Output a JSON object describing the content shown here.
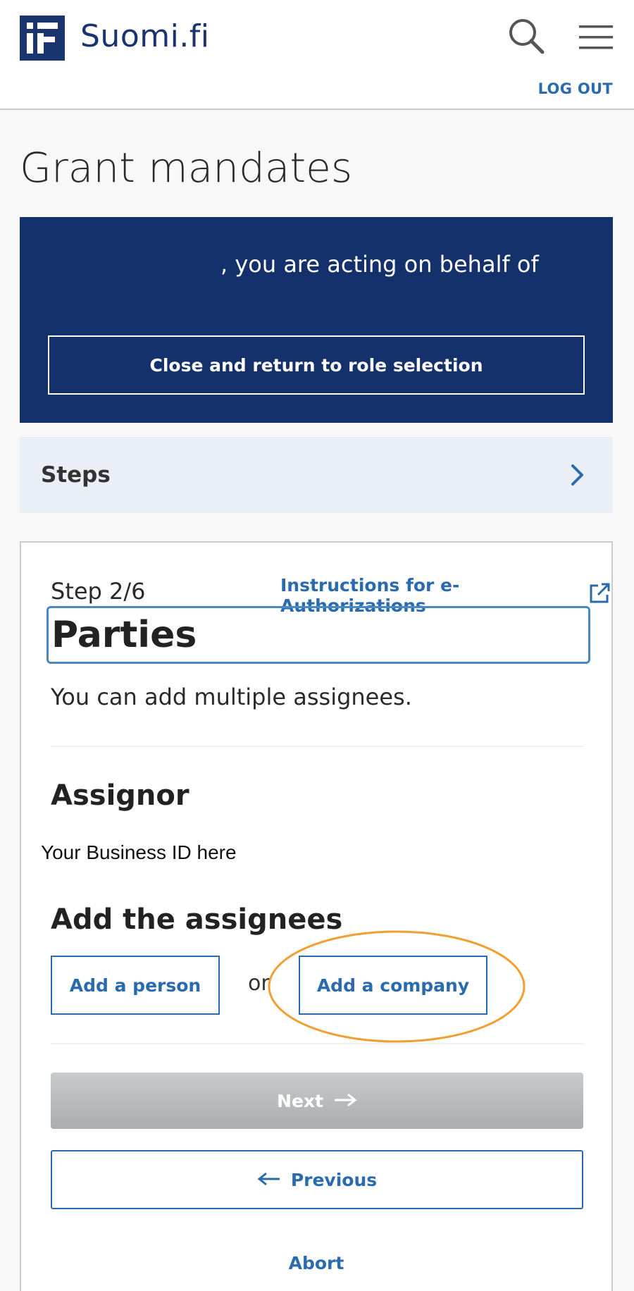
{
  "header": {
    "brand": "Suomi.fi",
    "logout_label": "LOG OUT"
  },
  "page_title": "Grant mandates",
  "banner": {
    "acting_text": ", you are acting on behalf of",
    "close_button": "Close and return to role selection"
  },
  "steps_bar": {
    "label": "Steps"
  },
  "card": {
    "step_indicator": "Step 2/6",
    "instructions_link": "Instructions for e-Authorizations",
    "section_title": "Parties",
    "intro": "You can add multiple assignees.",
    "assignor_heading": "Assignor",
    "assignor_value": "Your Business ID here",
    "assignees_heading": "Add the assignees",
    "add_person": "Add a person",
    "or_text": "or",
    "add_company": "Add a company",
    "next": "Next",
    "previous": "Previous",
    "abort": "Abort"
  },
  "colors": {
    "brand_navy": "#1a3470",
    "banner_blue": "#15316b",
    "link_blue": "#2a6bb0",
    "highlight_orange": "#f0a030",
    "disabled_gray": "#b0b4b7"
  },
  "icons": [
    "suomi-logo-icon",
    "search-icon",
    "hamburger-menu-icon",
    "chevron-right-icon",
    "external-link-icon",
    "arrow-right-icon",
    "arrow-left-icon"
  ]
}
